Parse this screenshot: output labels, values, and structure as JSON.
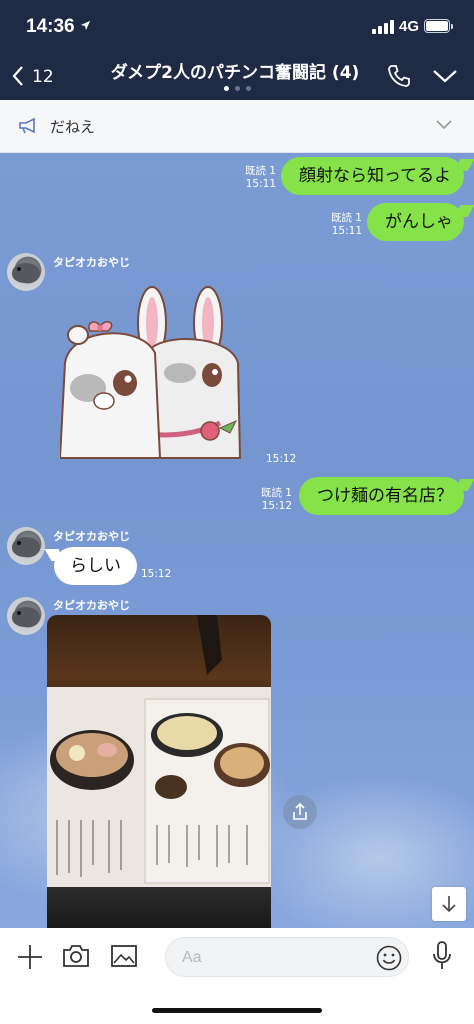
{
  "status": {
    "time": "14:36",
    "network": "4G"
  },
  "header": {
    "back_count": "12",
    "title": "ダメプ2人のパチンコ奮闘記 (4)"
  },
  "announcement": {
    "text": "だねえ"
  },
  "messages": {
    "m1": {
      "text": "顔射なら知ってるよ",
      "read": "既読 1",
      "time": "15:11"
    },
    "m2": {
      "text": "がんしゃ",
      "read": "既読 1",
      "time": "15:11"
    },
    "m3": {
      "sender": "タピオカおやじ",
      "time": "15:12"
    },
    "m4": {
      "text": "つけ麺の有名店？",
      "read": "既読 1",
      "time": "15:12"
    },
    "m5": {
      "sender": "タピオカおやじ",
      "text": "らしい",
      "time": "15:12"
    },
    "m6": {
      "sender": "タピオカおやじ"
    }
  },
  "input": {
    "placeholder": "Aa"
  },
  "colors": {
    "header": "#1f2a44",
    "outgoing": "#85e249",
    "chat_bg": "#7a9bd4"
  }
}
